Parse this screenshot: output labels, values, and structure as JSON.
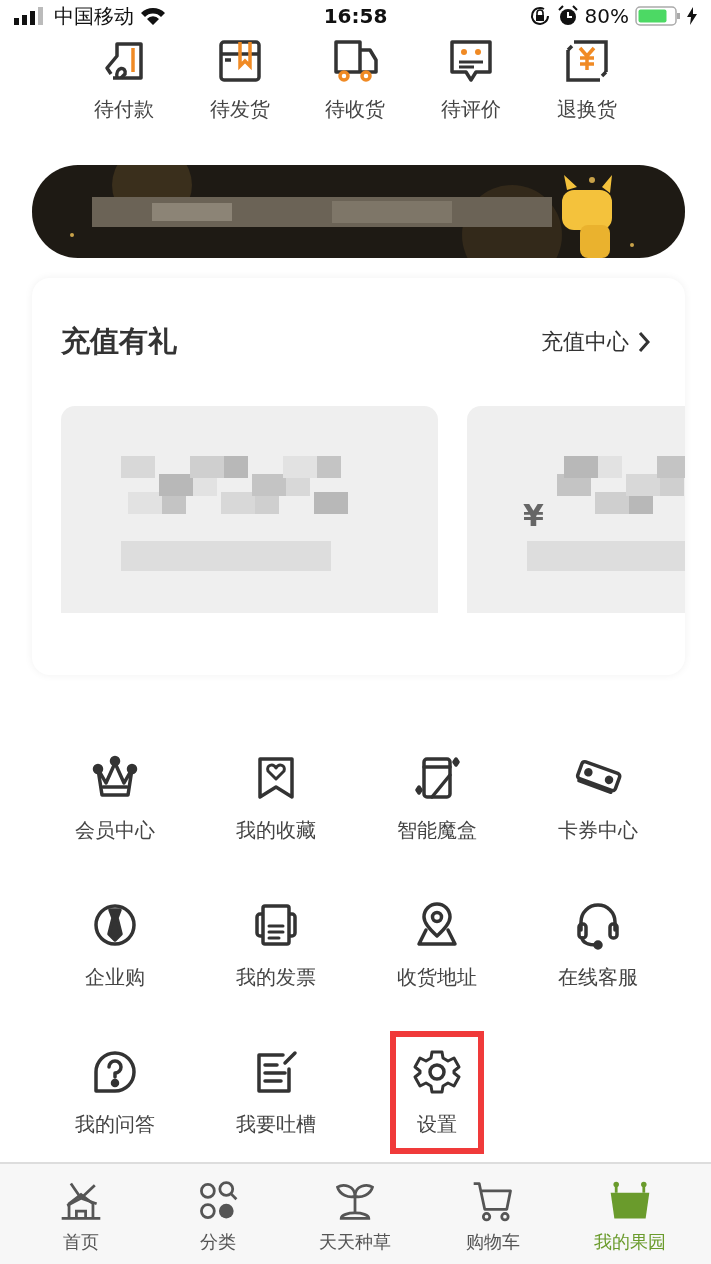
{
  "status_bar": {
    "carrier": "中国移动",
    "time": "16:58",
    "battery": "80%"
  },
  "orders": [
    {
      "label": "待付款"
    },
    {
      "label": "待发货"
    },
    {
      "label": "待收货"
    },
    {
      "label": "待评价"
    },
    {
      "label": "退换货"
    }
  ],
  "recharge": {
    "title": "充值有礼",
    "link": "充值中心",
    "cards": [
      {
        "kind": "card"
      },
      {
        "kind": "card",
        "currency": "¥"
      }
    ]
  },
  "services": [
    {
      "label": "会员中心",
      "highlighted": false
    },
    {
      "label": "我的收藏",
      "highlighted": false
    },
    {
      "label": "智能魔盒",
      "highlighted": false
    },
    {
      "label": "卡券中心",
      "highlighted": false
    },
    {
      "label": "企业购",
      "highlighted": false
    },
    {
      "label": "我的发票",
      "highlighted": false
    },
    {
      "label": "收货地址",
      "highlighted": false
    },
    {
      "label": "在线客服",
      "highlighted": false
    },
    {
      "label": "我的问答",
      "highlighted": false
    },
    {
      "label": "我要吐槽",
      "highlighted": false
    },
    {
      "label": "设置",
      "highlighted": true
    }
  ],
  "tab_bar": [
    {
      "label": "首页",
      "selected": false
    },
    {
      "label": "分类",
      "selected": false
    },
    {
      "label": "天天种草",
      "selected": false
    },
    {
      "label": "购物车",
      "selected": false
    },
    {
      "label": "我的果园",
      "selected": true
    }
  ]
}
